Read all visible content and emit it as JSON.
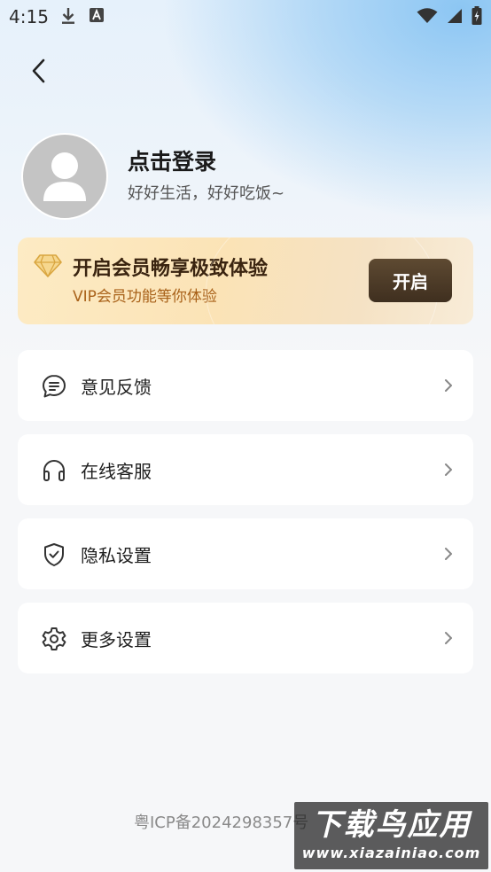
{
  "status_bar": {
    "time": "4:15",
    "icons": [
      "download-icon",
      "text-a-icon",
      "wifi-icon",
      "signal-icon",
      "battery-charging-icon"
    ]
  },
  "header": {
    "back_icon": "chevron-left-icon"
  },
  "profile": {
    "title": "点击登录",
    "subtitle": "好好生活，好好吃饭~",
    "avatar_icon": "user-avatar-icon"
  },
  "vip_card": {
    "title": "开启会员畅享极致体验",
    "subtitle": "VIP会员功能等你体验",
    "button_label": "开启",
    "icon": "diamond-icon",
    "colors": {
      "title": "#3a2410",
      "subtitle": "#a9621a",
      "button": "#4a3826",
      "diamond": "#e0b457"
    }
  },
  "menu": {
    "items": [
      {
        "label": "意见反馈",
        "icon": "feedback-chat-icon"
      },
      {
        "label": "在线客服",
        "icon": "headset-icon"
      },
      {
        "label": "隐私设置",
        "icon": "shield-check-icon"
      },
      {
        "label": "更多设置",
        "icon": "gear-icon"
      }
    ]
  },
  "footer": {
    "icp": "粤ICP备2024298357号"
  },
  "watermark": {
    "title": "下载鸟应用",
    "url": "www.xiazainiao.com"
  }
}
